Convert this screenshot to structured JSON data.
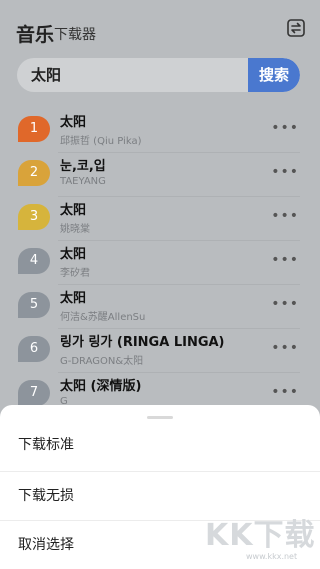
{
  "header": {
    "title": "音乐",
    "subtitle": "下载器",
    "switch_icon": "swap-icon"
  },
  "search": {
    "value": "太阳",
    "button_label": "搜索"
  },
  "songs": [
    {
      "rank": "1",
      "title": "太阳",
      "artist": "邱振哲 (Qiu Pika)",
      "badge_color": "#e0682a"
    },
    {
      "rank": "2",
      "title": "눈,코,입",
      "artist": "TAEYANG",
      "badge_color": "#d9a33a"
    },
    {
      "rank": "3",
      "title": "太阳",
      "artist": "姚晓棠",
      "badge_color": "#d6b43c"
    },
    {
      "rank": "4",
      "title": "太阳",
      "artist": "李矽君",
      "badge_color": "#8d949c"
    },
    {
      "rank": "5",
      "title": "太阳",
      "artist": "何洁&苏醒AllenSu",
      "badge_color": "#8d949c"
    },
    {
      "rank": "6",
      "title": "링가 링가 (RINGA LINGA)",
      "artist": "G-DRAGON&太阳",
      "badge_color": "#8d949c"
    },
    {
      "rank": "7",
      "title": "太阳 (深情版)",
      "artist": "G",
      "badge_color": "#8d949c"
    }
  ],
  "sheet": {
    "items": [
      "下载标准",
      "下载无损",
      "取消选择"
    ]
  },
  "watermark": {
    "logo": "KK下载",
    "url": "www.kkx.net"
  }
}
